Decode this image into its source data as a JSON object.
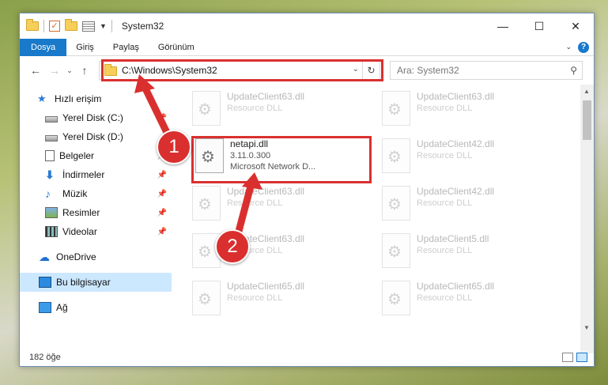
{
  "window": {
    "title": "System32"
  },
  "ribbon": {
    "tabs": [
      "Dosya",
      "Giriş",
      "Paylaş",
      "Görünüm"
    ]
  },
  "address": {
    "path": "C:\\Windows\\System32",
    "search_placeholder": "Ara: System32"
  },
  "sidebar": {
    "items": [
      {
        "label": "Hızlı erişim"
      },
      {
        "label": "Yerel Disk (C:)"
      },
      {
        "label": "Yerel Disk (D:)"
      },
      {
        "label": "Belgeler"
      },
      {
        "label": "İndirmeler"
      },
      {
        "label": "Müzik"
      },
      {
        "label": "Resimler"
      },
      {
        "label": "Videolar"
      },
      {
        "label": "OneDrive"
      },
      {
        "label": "Bu bilgisayar"
      },
      {
        "label": "Ağ"
      }
    ]
  },
  "files": [
    {
      "name": "UpdateClient63.dll",
      "sub": "Resource DLL"
    },
    {
      "name": "UpdateClient63.dll",
      "sub": "Resource DLL"
    },
    {
      "name": "UpdateClient42.dll",
      "sub": "Resource DLL"
    },
    {
      "name": "UpdateClient63.dll",
      "sub": "Resource DLL"
    },
    {
      "name": "UpdateClient42.dll",
      "sub": "Resource DLL"
    },
    {
      "name": "UpdateClient63.dll",
      "sub": "Resource DLL"
    },
    {
      "name": "UpdateClient5.dll",
      "sub": "Resource DLL"
    },
    {
      "name": "UpdateClient65.dll",
      "sub": "Resource DLL"
    },
    {
      "name": "UpdateClient65.dll",
      "sub": "Resource DLL"
    }
  ],
  "focused_file": {
    "name": "netapi.dll",
    "version": "3.11.0.300",
    "description": "Microsoft Network D..."
  },
  "status": {
    "count": "182 öğe"
  },
  "annotations": {
    "step1": "1",
    "step2": "2",
    "accent": "#d9302f"
  }
}
